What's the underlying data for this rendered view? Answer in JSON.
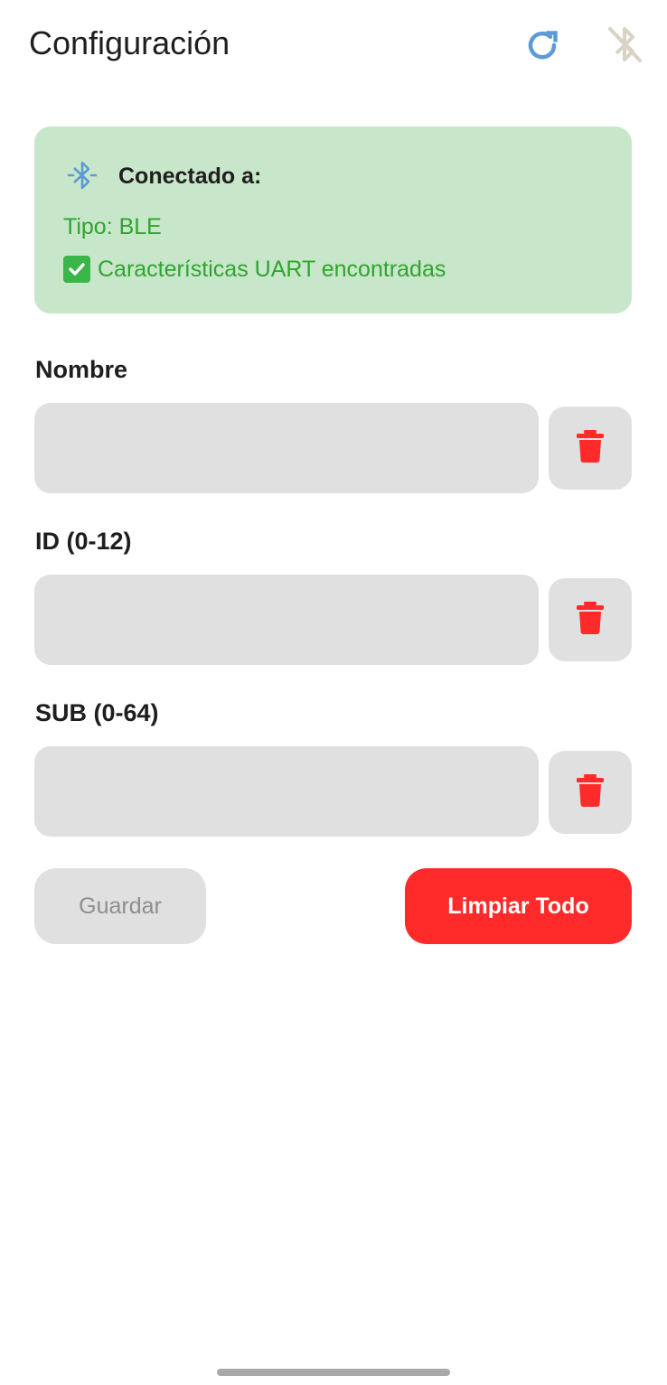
{
  "header": {
    "title": "Configuración",
    "refresh_icon": "refresh-icon",
    "bluetooth_icon": "bluetooth-disabled-icon"
  },
  "status": {
    "icon": "bluetooth-searching-icon",
    "label": "Conectado a:",
    "type_text": "Tipo: BLE",
    "uart_icon": "check-mark-box-icon",
    "uart_text": "Características UART encontradas",
    "color": "#c8e6c9",
    "text_color": "#2ea52e"
  },
  "fields": {
    "nombre": {
      "label": "Nombre",
      "value": ""
    },
    "id": {
      "label": "ID (0-12)",
      "value": ""
    },
    "sub": {
      "label": "SUB (0-64)",
      "value": ""
    },
    "trash_icon": "trash-icon"
  },
  "buttons": {
    "save_label": "Guardar",
    "clear_label": "Limpiar Todo",
    "clear_color": "#ff2b2b"
  }
}
